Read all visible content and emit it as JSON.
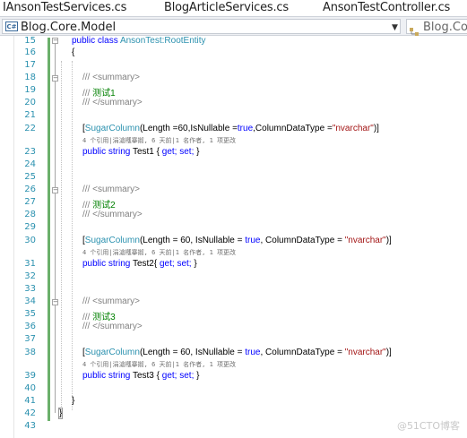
{
  "tabs": [
    {
      "label": "IAnsonTestServices.cs"
    },
    {
      "label": "BlogArticleServices.cs"
    },
    {
      "label": "AnsonTestController.cs"
    }
  ],
  "nav": {
    "project": "Blog.Core.Model",
    "right_project": "Blog.Core"
  },
  "code": {
    "class_kw1": "public",
    "class_kw2": "class",
    "class_decl": "AnsonTest:RootEntity",
    "open_brace": "{",
    "close_brace": "}",
    "close_brace_ns": "}",
    "summary_open": "/// <summary>",
    "summary_close": "/// </summary>",
    "comment_prefix": "/// ",
    "test1_comment": "测试1",
    "test2_comment": "测试2",
    "test3_comment": "测试3",
    "attr_name": "SugarColumn",
    "attr1_args": "(Length =60,IsNullable =",
    "attr2_args": "(Length = 60, IsNullable = ",
    "true": "true",
    "attr1_mid": ",ColumnDataType =",
    "attr2_mid": ", ColumnDataType = ",
    "str_val": "\"nvarchar\"",
    "attr_close": ")]",
    "attr_open": "[",
    "codelens": "4 个引用|涓滄槬搴掓, 6 天前|1 名作者, 1 项更改",
    "prop_kw": "public string",
    "prop1": " Test1 { ",
    "prop2": " Test2{ ",
    "prop3": " Test3 { ",
    "get_set": "get; set;",
    "prop_end": " }"
  },
  "line_numbers": [
    "15",
    "16",
    "17",
    "18",
    "19",
    "20",
    "21",
    "22",
    "23",
    "24",
    "25",
    "26",
    "27",
    "28",
    "29",
    "30",
    "31",
    "32",
    "33",
    "34",
    "35",
    "36",
    "37",
    "38",
    "39",
    "40",
    "41",
    "42",
    "43"
  ],
  "watermark": "@51CTO博客"
}
